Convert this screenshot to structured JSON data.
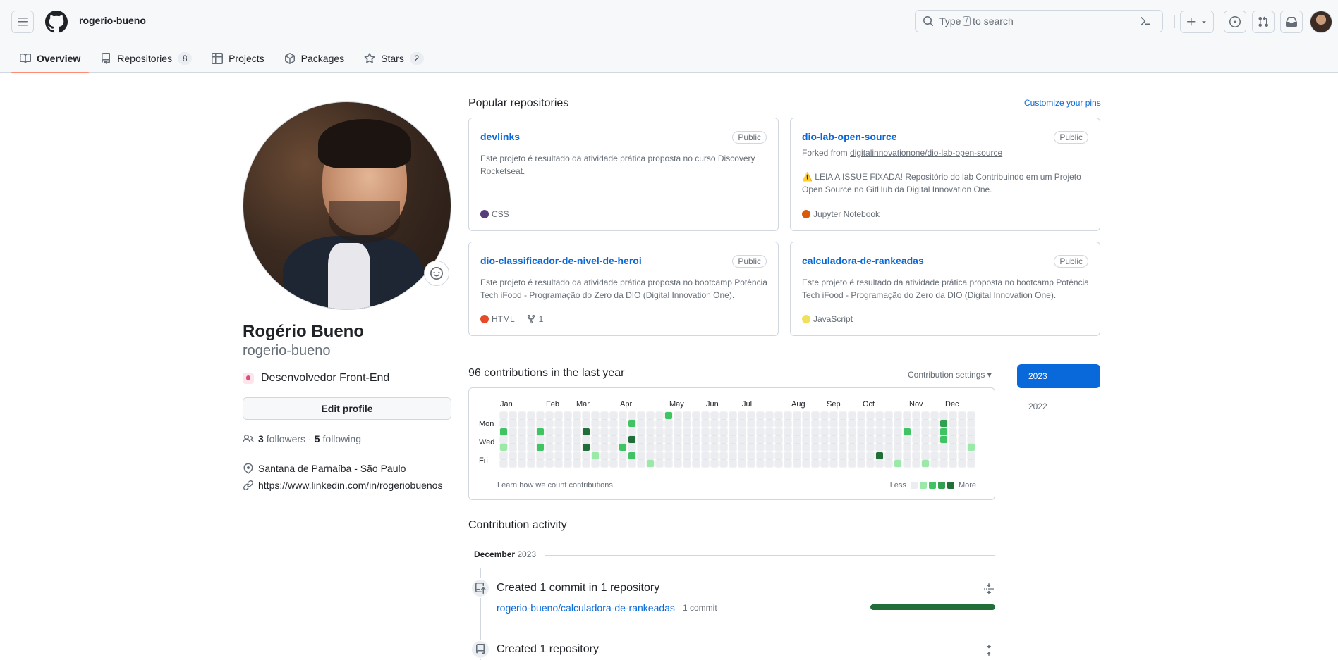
{
  "header": {
    "context_name": "rogerio-bueno",
    "search": {
      "prefix": "Type",
      "key": "/",
      "suffix": "to search"
    }
  },
  "tabs": [
    {
      "label": "Overview",
      "icon": "book-icon",
      "active": true
    },
    {
      "label": "Repositories",
      "icon": "repo-icon",
      "count": "8"
    },
    {
      "label": "Projects",
      "icon": "table-icon"
    },
    {
      "label": "Packages",
      "icon": "package-icon"
    },
    {
      "label": "Stars",
      "icon": "star-icon",
      "count": "2"
    }
  ],
  "profile": {
    "name": "Rogério Bueno",
    "login": "rogerio-bueno",
    "status": "Desenvolvedor Front-End",
    "edit_label": "Edit profile",
    "followers_count": "3",
    "followers_label": "followers",
    "following_count": "5",
    "following_label": "following",
    "separator": "·",
    "location": "Santana de Parnaíba - São Paulo",
    "website": "https://www.linkedin.com/in/rogeriobuenos"
  },
  "popular": {
    "title": "Popular repositories",
    "customize": "Customize your pins",
    "repos": [
      {
        "name": "devlinks",
        "visibility": "Public",
        "description": "Este projeto é resultado da atividade prática proposta no curso Discovery Rocketseat.",
        "language": "CSS",
        "language_color": "#563d7c"
      },
      {
        "name": "dio-lab-open-source",
        "visibility": "Public",
        "forked_prefix": "Forked from",
        "forked_from": "digitalinnovationone/dio-lab-open-source",
        "description": "⚠️ LEIA A ISSUE FIXADA! Repositório do lab Contribuindo em um Projeto Open Source no GitHub da Digital Innovation One.",
        "language": "Jupyter Notebook",
        "language_color": "#DA5B0B"
      },
      {
        "name": "dio-classificador-de-nivel-de-heroi",
        "visibility": "Public",
        "description": "Este projeto é resultado da atividade prática proposta no bootcamp Potência Tech iFood - Programação do Zero da DIO (Digital Innovation One).",
        "language": "HTML",
        "language_color": "#e34c26",
        "forks": "1"
      },
      {
        "name": "calculadora-de-rankeadas",
        "visibility": "Public",
        "description": "Este projeto é resultado da atividade prática proposta no bootcamp Potência Tech iFood - Programação do Zero da DIO (Digital Innovation One).",
        "language": "JavaScript",
        "language_color": "#f1e05a"
      }
    ]
  },
  "contributions": {
    "title": "96 contributions in the last year",
    "settings": "Contribution settings ▾",
    "months": [
      "Jan",
      "Feb",
      "Mar",
      "Apr",
      "May",
      "Jun",
      "Jul",
      "Aug",
      "Sep",
      "Oct",
      "Nov",
      "Dec"
    ],
    "day_labels": [
      "Mon",
      "Wed",
      "Fri"
    ],
    "learn": "Learn how we count contributions",
    "less": "Less",
    "more": "More",
    "colors": [
      "#ebedf0",
      "#9be9a8",
      "#40c463",
      "#30a14e",
      "#216e39"
    ],
    "active_cells": [
      {
        "week": 0,
        "day": 2,
        "level": 2
      },
      {
        "week": 0,
        "day": 4,
        "level": 1
      },
      {
        "week": 4,
        "day": 2,
        "level": 2
      },
      {
        "week": 4,
        "day": 4,
        "level": 2
      },
      {
        "week": 9,
        "day": 2,
        "level": 4
      },
      {
        "week": 9,
        "day": 4,
        "level": 4
      },
      {
        "week": 10,
        "day": 5,
        "level": 1
      },
      {
        "week": 13,
        "day": 4,
        "level": 2
      },
      {
        "week": 14,
        "day": 1,
        "level": 2
      },
      {
        "week": 14,
        "day": 3,
        "level": 4
      },
      {
        "week": 14,
        "day": 5,
        "level": 2
      },
      {
        "week": 16,
        "day": 6,
        "level": 1
      },
      {
        "week": 18,
        "day": 0,
        "level": 2
      },
      {
        "week": 41,
        "day": 5,
        "level": 4
      },
      {
        "week": 43,
        "day": 6,
        "level": 1
      },
      {
        "week": 44,
        "day": 2,
        "level": 2
      },
      {
        "week": 46,
        "day": 6,
        "level": 1
      },
      {
        "week": 48,
        "day": 1,
        "level": 3
      },
      {
        "week": 48,
        "day": 2,
        "level": 2
      },
      {
        "week": 48,
        "day": 3,
        "level": 2
      },
      {
        "week": 51,
        "day": 4,
        "level": 1
      }
    ]
  },
  "years": [
    "2023",
    "2022"
  ],
  "activity": {
    "title": "Contribution activity",
    "month": "December",
    "year": "2023",
    "items": [
      {
        "text": "Created 1 commit in 1 repository",
        "repo": "rogerio-bueno/calculadora-de-rankeadas",
        "count": "1 commit"
      },
      {
        "text": "Created 1 repository"
      }
    ]
  }
}
